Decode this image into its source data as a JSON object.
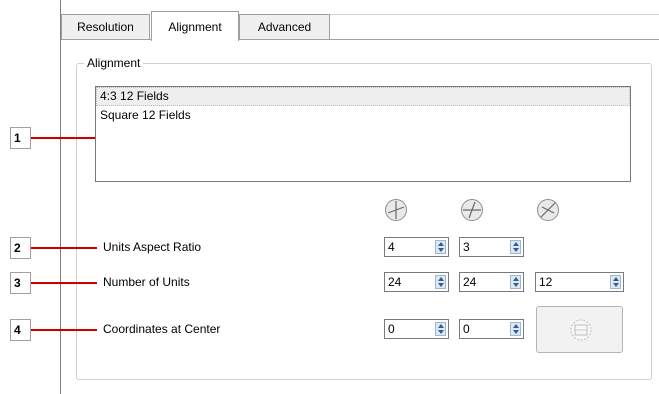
{
  "tabs": [
    {
      "label": "Resolution",
      "active": false
    },
    {
      "label": "Alignment",
      "active": true
    },
    {
      "label": "Advanced",
      "active": false
    }
  ],
  "group": {
    "title": "Alignment"
  },
  "list": {
    "items": [
      "4:3 12 Fields",
      "Square 12 Fields"
    ],
    "selected_index": 0
  },
  "callouts": [
    "1",
    "2",
    "3",
    "4"
  ],
  "icons": {
    "flip_x": "flip-circle-icon",
    "flip_y": "flip-circle-icon",
    "flip_z": "flip-circle-icon",
    "center": "center-target-icon"
  },
  "rows": {
    "aspect_ratio": {
      "label": "Units Aspect Ratio",
      "x": "4",
      "y": "3"
    },
    "num_units": {
      "label": "Number of Units",
      "x": "24",
      "y": "24",
      "z": "12"
    },
    "center": {
      "label": "Coordinates at Center",
      "x": "0",
      "y": "0"
    }
  },
  "colors": {
    "callout_line": "#cc0000"
  }
}
